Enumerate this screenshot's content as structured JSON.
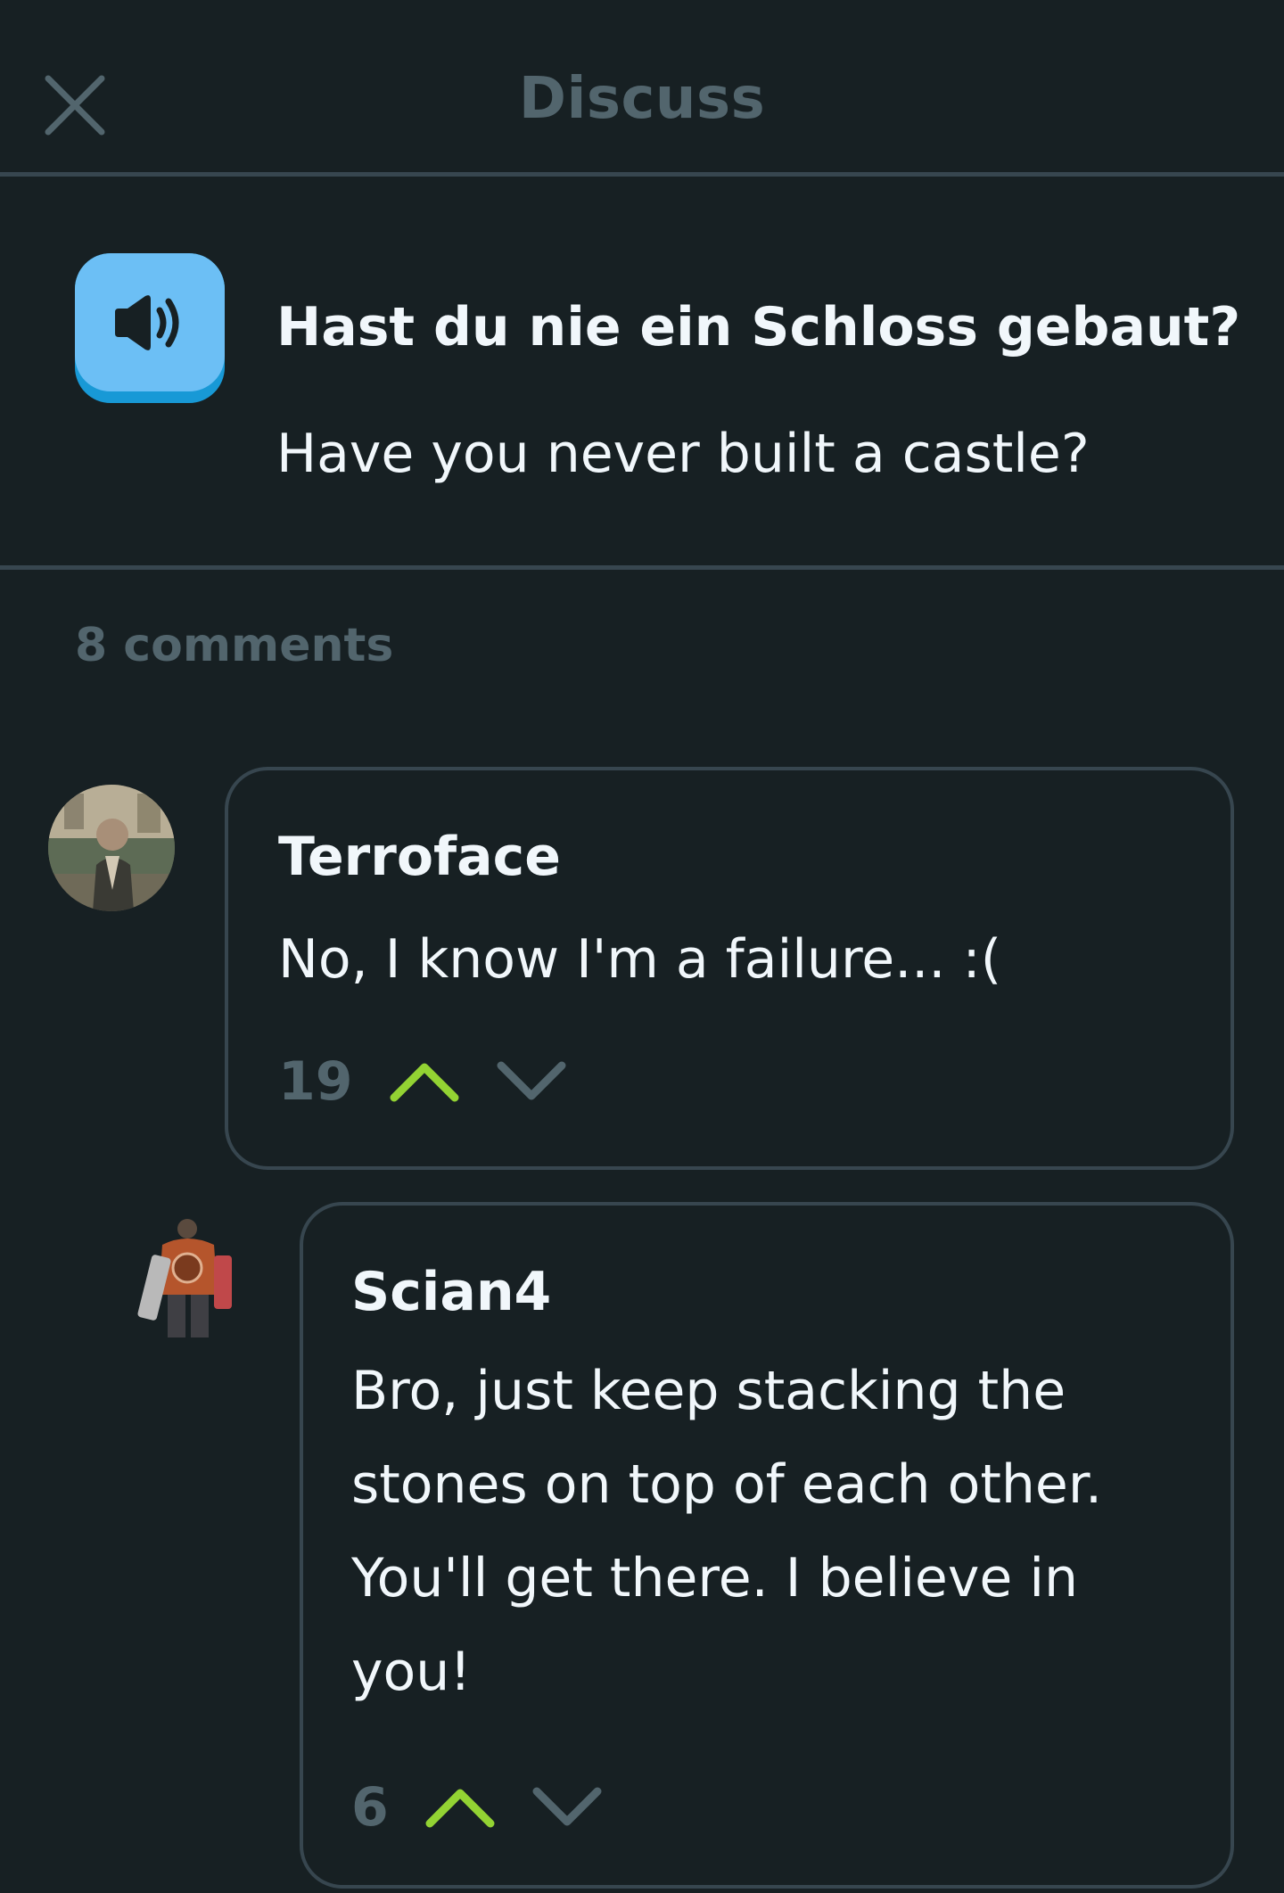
{
  "header": {
    "title": "Discuss",
    "close_icon": "close-icon"
  },
  "sentence": {
    "original": "Hast du nie ein Schloss gebaut?",
    "translation": "Have you never built a castle?",
    "speaker_icon": "speaker-icon"
  },
  "comments_count_label": "8 comments",
  "comments": [
    {
      "author": "Terroface",
      "text": "No, I know I'm a failure... :(",
      "votes": "19",
      "upvoted": true
    },
    {
      "author": "Scian4",
      "text": "Bro, just keep stacking the stones on top of each other. You'll get there. I believe in you!",
      "votes": "6",
      "upvoted": true
    }
  ],
  "colors": {
    "background": "#172023",
    "divider": "#37464F",
    "muted_text": "#52656D",
    "text": "#F1F7FB",
    "speaker_blue": "#6CBFF5",
    "upvote_green": "#93D333"
  }
}
